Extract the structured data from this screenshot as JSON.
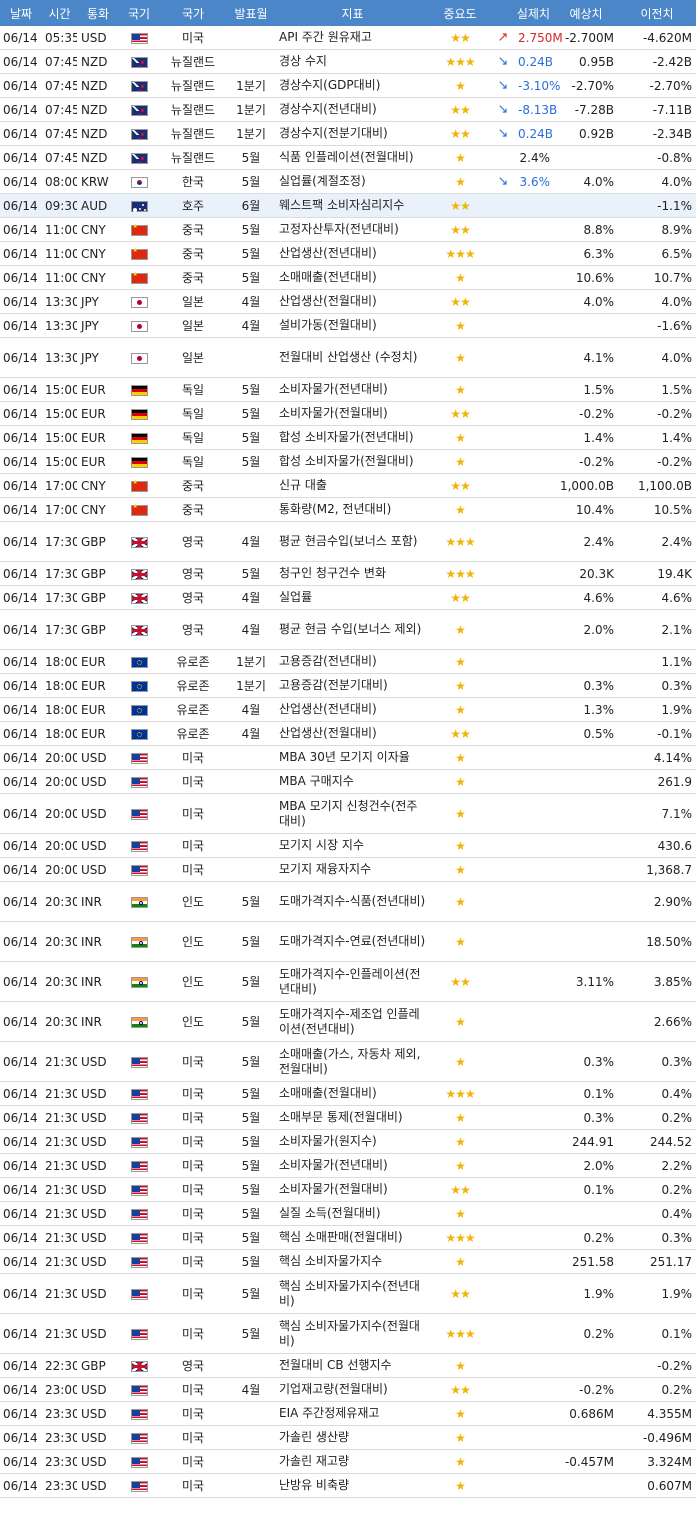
{
  "headers": [
    "날짜",
    "시간",
    "통화",
    "국기",
    "국가",
    "발표월",
    "지표",
    "중요도",
    "",
    "실제치",
    "예상치",
    "이전치"
  ],
  "star_color": "#f2b30a",
  "header_color": "#4a86c8",
  "rows": [
    {
      "date": "06/14",
      "time": "05:35",
      "cur": "USD",
      "flag": "us",
      "country": "미국",
      "period": "",
      "ind": "API 주간 원유재고",
      "imp": "★★",
      "arrow": "up",
      "actual": "2.750M",
      "fcst": "-2.700M",
      "prev": "-4.620M"
    },
    {
      "date": "06/14",
      "time": "07:45",
      "cur": "NZD",
      "flag": "nz",
      "country": "뉴질랜드",
      "period": "",
      "ind": "경상 수지",
      "imp": "★★★",
      "arrow": "down",
      "actual": "0.24B",
      "fcst": "0.95B",
      "prev": "-2.42B"
    },
    {
      "date": "06/14",
      "time": "07:45",
      "cur": "NZD",
      "flag": "nz",
      "country": "뉴질랜드",
      "period": "1분기",
      "ind": "경상수지(GDP대비)",
      "imp": "★",
      "arrow": "down",
      "actual": "-3.10%",
      "fcst": "-2.70%",
      "prev": "-2.70%"
    },
    {
      "date": "06/14",
      "time": "07:45",
      "cur": "NZD",
      "flag": "nz",
      "country": "뉴질랜드",
      "period": "1분기",
      "ind": "경상수지(전년대비)",
      "imp": "★★",
      "arrow": "down",
      "actual": "-8.13B",
      "fcst": "-7.28B",
      "prev": "-7.11B"
    },
    {
      "date": "06/14",
      "time": "07:45",
      "cur": "NZD",
      "flag": "nz",
      "country": "뉴질랜드",
      "period": "1분기",
      "ind": "경상수지(전분기대비)",
      "imp": "★★",
      "arrow": "down",
      "actual": "0.24B",
      "fcst": "0.92B",
      "prev": "-2.34B"
    },
    {
      "date": "06/14",
      "time": "07:45",
      "cur": "NZD",
      "flag": "nz",
      "country": "뉴질랜드",
      "period": "5월",
      "ind": "식품 인플레이션(전월대비)",
      "imp": "★",
      "arrow": "",
      "actual": "2.4%",
      "fcst": "",
      "prev": "-0.8%"
    },
    {
      "date": "06/14",
      "time": "08:00",
      "cur": "KRW",
      "flag": "kr",
      "country": "한국",
      "period": "5월",
      "ind": "실업률(계절조정)",
      "imp": "★",
      "arrow": "down",
      "actual": "3.6%",
      "fcst": "4.0%",
      "prev": "4.0%"
    },
    {
      "date": "06/14",
      "time": "09:30",
      "cur": "AUD",
      "flag": "au",
      "country": "호주",
      "period": "6월",
      "ind": "웨스트팩 소비자심리지수",
      "imp": "★★",
      "arrow": "",
      "actual": "",
      "fcst": "",
      "prev": "-1.1%",
      "highlight": true
    },
    {
      "date": "06/14",
      "time": "11:00",
      "cur": "CNY",
      "flag": "cn",
      "country": "중국",
      "period": "5월",
      "ind": "고정자산투자(전년대비)",
      "imp": "★★",
      "arrow": "",
      "actual": "",
      "fcst": "8.8%",
      "prev": "8.9%"
    },
    {
      "date": "06/14",
      "time": "11:00",
      "cur": "CNY",
      "flag": "cn",
      "country": "중국",
      "period": "5월",
      "ind": "산업생산(전년대비)",
      "imp": "★★★",
      "arrow": "",
      "actual": "",
      "fcst": "6.3%",
      "prev": "6.5%"
    },
    {
      "date": "06/14",
      "time": "11:00",
      "cur": "CNY",
      "flag": "cn",
      "country": "중국",
      "period": "5월",
      "ind": "소매매출(전년대비)",
      "imp": "★",
      "arrow": "",
      "actual": "",
      "fcst": "10.6%",
      "prev": "10.7%"
    },
    {
      "date": "06/14",
      "time": "13:30",
      "cur": "JPY",
      "flag": "jp",
      "country": "일본",
      "period": "4월",
      "ind": "산업생산(전월대비)",
      "imp": "★★",
      "arrow": "",
      "actual": "",
      "fcst": "4.0%",
      "prev": "4.0%"
    },
    {
      "date": "06/14",
      "time": "13:30",
      "cur": "JPY",
      "flag": "jp",
      "country": "일본",
      "period": "4월",
      "ind": "설비가동(전월대비)",
      "imp": "★",
      "arrow": "",
      "actual": "",
      "fcst": "",
      "prev": "-1.6%"
    },
    {
      "date": "06/14",
      "time": "13:30",
      "cur": "JPY",
      "flag": "jp",
      "country": "일본",
      "period": "",
      "ind": "전월대비 산업생산 (수정치)",
      "imp": "★",
      "arrow": "",
      "actual": "",
      "fcst": "4.1%",
      "prev": "4.0%",
      "tall": true
    },
    {
      "date": "06/14",
      "time": "15:00",
      "cur": "EUR",
      "flag": "de",
      "country": "독일",
      "period": "5월",
      "ind": "소비자물가(전년대비)",
      "imp": "★",
      "arrow": "",
      "actual": "",
      "fcst": "1.5%",
      "prev": "1.5%"
    },
    {
      "date": "06/14",
      "time": "15:00",
      "cur": "EUR",
      "flag": "de",
      "country": "독일",
      "period": "5월",
      "ind": "소비자물가(전월대비)",
      "imp": "★★",
      "arrow": "",
      "actual": "",
      "fcst": "-0.2%",
      "prev": "-0.2%"
    },
    {
      "date": "06/14",
      "time": "15:00",
      "cur": "EUR",
      "flag": "de",
      "country": "독일",
      "period": "5월",
      "ind": "합성 소비자물가(전년대비)",
      "imp": "★",
      "arrow": "",
      "actual": "",
      "fcst": "1.4%",
      "prev": "1.4%"
    },
    {
      "date": "06/14",
      "time": "15:00",
      "cur": "EUR",
      "flag": "de",
      "country": "독일",
      "period": "5월",
      "ind": "합성 소비자물가(전월대비)",
      "imp": "★",
      "arrow": "",
      "actual": "",
      "fcst": "-0.2%",
      "prev": "-0.2%"
    },
    {
      "date": "06/14",
      "time": "17:00",
      "cur": "CNY",
      "flag": "cn",
      "country": "중국",
      "period": "",
      "ind": "신규 대출",
      "imp": "★★",
      "arrow": "",
      "actual": "",
      "fcst": "1,000.0B",
      "prev": "1,100.0B"
    },
    {
      "date": "06/14",
      "time": "17:00",
      "cur": "CNY",
      "flag": "cn",
      "country": "중국",
      "period": "",
      "ind": "통화량(M2, 전년대비)",
      "imp": "★",
      "arrow": "",
      "actual": "",
      "fcst": "10.4%",
      "prev": "10.5%"
    },
    {
      "date": "06/14",
      "time": "17:30",
      "cur": "GBP",
      "flag": "gb",
      "country": "영국",
      "period": "4월",
      "ind": "평균 현금수입(보너스 포함)",
      "imp": "★★★",
      "arrow": "",
      "actual": "",
      "fcst": "2.4%",
      "prev": "2.4%",
      "tall": true
    },
    {
      "date": "06/14",
      "time": "17:30",
      "cur": "GBP",
      "flag": "gb",
      "country": "영국",
      "period": "5월",
      "ind": "청구인 청구건수 변화",
      "imp": "★★★",
      "arrow": "",
      "actual": "",
      "fcst": "20.3K",
      "prev": "19.4K"
    },
    {
      "date": "06/14",
      "time": "17:30",
      "cur": "GBP",
      "flag": "gb",
      "country": "영국",
      "period": "4월",
      "ind": "실업률",
      "imp": "★★",
      "arrow": "",
      "actual": "",
      "fcst": "4.6%",
      "prev": "4.6%"
    },
    {
      "date": "06/14",
      "time": "17:30",
      "cur": "GBP",
      "flag": "gb",
      "country": "영국",
      "period": "4월",
      "ind": "평균 현금 수입(보너스 제외)",
      "imp": "★",
      "arrow": "",
      "actual": "",
      "fcst": "2.0%",
      "prev": "2.1%",
      "tall": true
    },
    {
      "date": "06/14",
      "time": "18:00",
      "cur": "EUR",
      "flag": "eu",
      "country": "유로존",
      "period": "1분기",
      "ind": "고용증감(전년대비)",
      "imp": "★",
      "arrow": "",
      "actual": "",
      "fcst": "",
      "prev": "1.1%"
    },
    {
      "date": "06/14",
      "time": "18:00",
      "cur": "EUR",
      "flag": "eu",
      "country": "유로존",
      "period": "1분기",
      "ind": "고용증감(전분기대비)",
      "imp": "★",
      "arrow": "",
      "actual": "",
      "fcst": "0.3%",
      "prev": "0.3%"
    },
    {
      "date": "06/14",
      "time": "18:00",
      "cur": "EUR",
      "flag": "eu",
      "country": "유로존",
      "period": "4월",
      "ind": "산업생산(전년대비)",
      "imp": "★",
      "arrow": "",
      "actual": "",
      "fcst": "1.3%",
      "prev": "1.9%"
    },
    {
      "date": "06/14",
      "time": "18:00",
      "cur": "EUR",
      "flag": "eu",
      "country": "유로존",
      "period": "4월",
      "ind": "산업생산(전월대비)",
      "imp": "★★",
      "arrow": "",
      "actual": "",
      "fcst": "0.5%",
      "prev": "-0.1%"
    },
    {
      "date": "06/14",
      "time": "20:00",
      "cur": "USD",
      "flag": "us",
      "country": "미국",
      "period": "",
      "ind": "MBA 30년 모기지 이자율",
      "imp": "★",
      "arrow": "",
      "actual": "",
      "fcst": "",
      "prev": "4.14%"
    },
    {
      "date": "06/14",
      "time": "20:00",
      "cur": "USD",
      "flag": "us",
      "country": "미국",
      "period": "",
      "ind": "MBA 구매지수",
      "imp": "★",
      "arrow": "",
      "actual": "",
      "fcst": "",
      "prev": "261.9"
    },
    {
      "date": "06/14",
      "time": "20:00",
      "cur": "USD",
      "flag": "us",
      "country": "미국",
      "period": "",
      "ind": "MBA 모기지 신청건수(전주대비)",
      "imp": "★",
      "arrow": "",
      "actual": "",
      "fcst": "",
      "prev": "7.1%",
      "tall": true
    },
    {
      "date": "06/14",
      "time": "20:00",
      "cur": "USD",
      "flag": "us",
      "country": "미국",
      "period": "",
      "ind": "모기지 시장 지수",
      "imp": "★",
      "arrow": "",
      "actual": "",
      "fcst": "",
      "prev": "430.6"
    },
    {
      "date": "06/14",
      "time": "20:00",
      "cur": "USD",
      "flag": "us",
      "country": "미국",
      "period": "",
      "ind": "모기지 재융자지수",
      "imp": "★",
      "arrow": "",
      "actual": "",
      "fcst": "",
      "prev": "1,368.7"
    },
    {
      "date": "06/14",
      "time": "20:30",
      "cur": "INR",
      "flag": "in",
      "country": "인도",
      "period": "5월",
      "ind": "도매가격지수-식품(전년대비)",
      "imp": "★",
      "arrow": "",
      "actual": "",
      "fcst": "",
      "prev": "2.90%",
      "tall": true
    },
    {
      "date": "06/14",
      "time": "20:30",
      "cur": "INR",
      "flag": "in",
      "country": "인도",
      "period": "5월",
      "ind": "도매가격지수-연료(전년대비)",
      "imp": "★",
      "arrow": "",
      "actual": "",
      "fcst": "",
      "prev": "18.50%",
      "tall": true
    },
    {
      "date": "06/14",
      "time": "20:30",
      "cur": "INR",
      "flag": "in",
      "country": "인도",
      "period": "5월",
      "ind": "도매가격지수-인플레이션(전년대비)",
      "imp": "★★",
      "arrow": "",
      "actual": "",
      "fcst": "3.11%",
      "prev": "3.85%",
      "tall": true
    },
    {
      "date": "06/14",
      "time": "20:30",
      "cur": "INR",
      "flag": "in",
      "country": "인도",
      "period": "5월",
      "ind": "도매가격지수-제조업 인플레이션(전년대비)",
      "imp": "★",
      "arrow": "",
      "actual": "",
      "fcst": "",
      "prev": "2.66%",
      "tall": true
    },
    {
      "date": "06/14",
      "time": "21:30",
      "cur": "USD",
      "flag": "us",
      "country": "미국",
      "period": "5월",
      "ind": "소매매출(가스, 자동차 제외, 전월대비)",
      "imp": "★",
      "arrow": "",
      "actual": "",
      "fcst": "0.3%",
      "prev": "0.3%",
      "tall": true
    },
    {
      "date": "06/14",
      "time": "21:30",
      "cur": "USD",
      "flag": "us",
      "country": "미국",
      "period": "5월",
      "ind": "소매매출(전월대비)",
      "imp": "★★★",
      "arrow": "",
      "actual": "",
      "fcst": "0.1%",
      "prev": "0.4%"
    },
    {
      "date": "06/14",
      "time": "21:30",
      "cur": "USD",
      "flag": "us",
      "country": "미국",
      "period": "5월",
      "ind": "소매부문 통제(전월대비)",
      "imp": "★",
      "arrow": "",
      "actual": "",
      "fcst": "0.3%",
      "prev": "0.2%"
    },
    {
      "date": "06/14",
      "time": "21:30",
      "cur": "USD",
      "flag": "us",
      "country": "미국",
      "period": "5월",
      "ind": "소비자물가(원지수)",
      "imp": "★",
      "arrow": "",
      "actual": "",
      "fcst": "244.91",
      "prev": "244.52"
    },
    {
      "date": "06/14",
      "time": "21:30",
      "cur": "USD",
      "flag": "us",
      "country": "미국",
      "period": "5월",
      "ind": "소비자물가(전년대비)",
      "imp": "★",
      "arrow": "",
      "actual": "",
      "fcst": "2.0%",
      "prev": "2.2%"
    },
    {
      "date": "06/14",
      "time": "21:30",
      "cur": "USD",
      "flag": "us",
      "country": "미국",
      "period": "5월",
      "ind": "소비자물가(전월대비)",
      "imp": "★★",
      "arrow": "",
      "actual": "",
      "fcst": "0.1%",
      "prev": "0.2%"
    },
    {
      "date": "06/14",
      "time": "21:30",
      "cur": "USD",
      "flag": "us",
      "country": "미국",
      "period": "5월",
      "ind": "실질 소득(전월대비)",
      "imp": "★",
      "arrow": "",
      "actual": "",
      "fcst": "",
      "prev": "0.4%"
    },
    {
      "date": "06/14",
      "time": "21:30",
      "cur": "USD",
      "flag": "us",
      "country": "미국",
      "period": "5월",
      "ind": "핵심 소매판매(전월대비)",
      "imp": "★★★",
      "arrow": "",
      "actual": "",
      "fcst": "0.2%",
      "prev": "0.3%"
    },
    {
      "date": "06/14",
      "time": "21:30",
      "cur": "USD",
      "flag": "us",
      "country": "미국",
      "period": "5월",
      "ind": "핵심 소비자물가지수",
      "imp": "★",
      "arrow": "",
      "actual": "",
      "fcst": "251.58",
      "prev": "251.17"
    },
    {
      "date": "06/14",
      "time": "21:30",
      "cur": "USD",
      "flag": "us",
      "country": "미국",
      "period": "5월",
      "ind": "핵심 소비자물가지수(전년대비)",
      "imp": "★★",
      "arrow": "",
      "actual": "",
      "fcst": "1.9%",
      "prev": "1.9%",
      "tall": true
    },
    {
      "date": "06/14",
      "time": "21:30",
      "cur": "USD",
      "flag": "us",
      "country": "미국",
      "period": "5월",
      "ind": "핵심 소비자물가지수(전월대비)",
      "imp": "★★★",
      "arrow": "",
      "actual": "",
      "fcst": "0.2%",
      "prev": "0.1%",
      "tall": true
    },
    {
      "date": "06/14",
      "time": "22:30",
      "cur": "GBP",
      "flag": "gb",
      "country": "영국",
      "period": "",
      "ind": "전월대비 CB 선행지수",
      "imp": "★",
      "arrow": "",
      "actual": "",
      "fcst": "",
      "prev": "-0.2%"
    },
    {
      "date": "06/14",
      "time": "23:00",
      "cur": "USD",
      "flag": "us",
      "country": "미국",
      "period": "4월",
      "ind": "기업재고량(전월대비)",
      "imp": "★★",
      "arrow": "",
      "actual": "",
      "fcst": "-0.2%",
      "prev": "0.2%"
    },
    {
      "date": "06/14",
      "time": "23:30",
      "cur": "USD",
      "flag": "us",
      "country": "미국",
      "period": "",
      "ind": "EIA 주간정제유재고",
      "imp": "★",
      "arrow": "",
      "actual": "",
      "fcst": "0.686M",
      "prev": "4.355M"
    },
    {
      "date": "06/14",
      "time": "23:30",
      "cur": "USD",
      "flag": "us",
      "country": "미국",
      "period": "",
      "ind": "가솔린 생산량",
      "imp": "★",
      "arrow": "",
      "actual": "",
      "fcst": "",
      "prev": "-0.496M"
    },
    {
      "date": "06/14",
      "time": "23:30",
      "cur": "USD",
      "flag": "us",
      "country": "미국",
      "period": "",
      "ind": "가솔린 재고량",
      "imp": "★",
      "arrow": "",
      "actual": "",
      "fcst": "-0.457M",
      "prev": "3.324M"
    },
    {
      "date": "06/14",
      "time": "23:30",
      "cur": "USD",
      "flag": "us",
      "country": "미국",
      "period": "",
      "ind": "난방유 비축량",
      "imp": "★",
      "arrow": "",
      "actual": "",
      "fcst": "",
      "prev": "0.607M"
    }
  ]
}
